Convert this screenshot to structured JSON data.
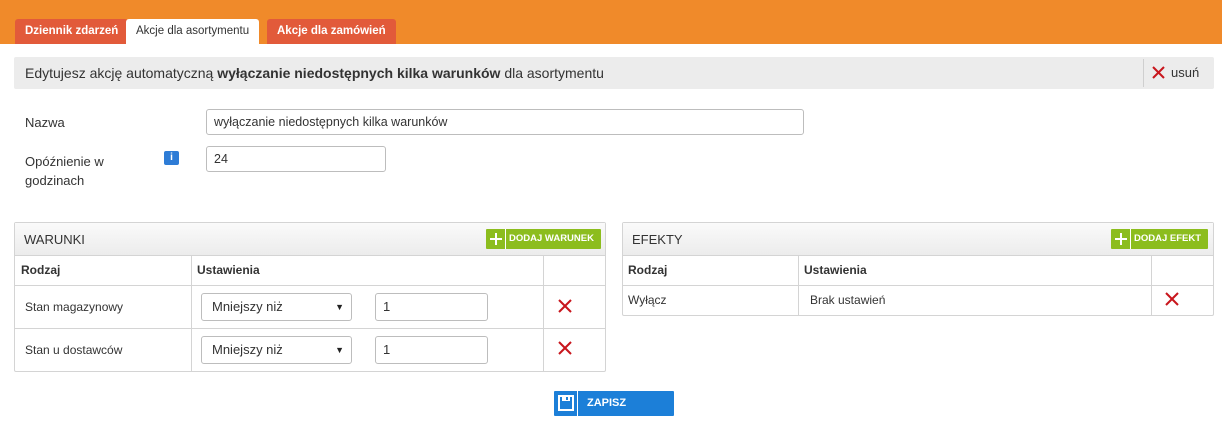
{
  "tabs": [
    {
      "label": "Dziennik zdarzeń",
      "active": false
    },
    {
      "label": "Akcje dla asortymentu",
      "active": true
    },
    {
      "label": "Akcje dla zamówień",
      "active": false
    }
  ],
  "header": {
    "prefix": "Edytujesz akcję automatyczną",
    "action_name": "wyłączanie niedostępnych kilka warunków",
    "suffix": "dla asortymentu",
    "delete_label": "usuń"
  },
  "form": {
    "name_label": "Nazwa",
    "name_value": "wyłączanie niedostępnych kilka warunków",
    "delay_label_line1": "Opóźnienie w",
    "delay_label_line2": "godzinach",
    "delay_info_icon": "i",
    "delay_value": "24"
  },
  "conditions": {
    "title": "WARUNKI",
    "add_label": "DODAJ WARUNEK",
    "col_type": "Rodzaj",
    "col_settings": "Ustawienia",
    "rows": [
      {
        "type": "Stan magazynowy",
        "operator": "Mniejszy niż",
        "value": "1"
      },
      {
        "type": "Stan u dostawców",
        "operator": "Mniejszy niż",
        "value": "1"
      }
    ]
  },
  "effects": {
    "title": "EFEKTY",
    "add_label": "DODAJ EFEKT",
    "col_type": "Rodzaj",
    "col_settings": "Ustawienia",
    "rows": [
      {
        "type": "Wyłącz",
        "settings": "Brak ustawień"
      }
    ]
  },
  "save_label": "ZAPISZ",
  "colors": {
    "topbar": "#f08a2a",
    "tab_inactive": "#e25a3a",
    "add_button": "#8cbd1e",
    "save_button": "#1c7fd8",
    "delete_x": "#c8161d"
  }
}
